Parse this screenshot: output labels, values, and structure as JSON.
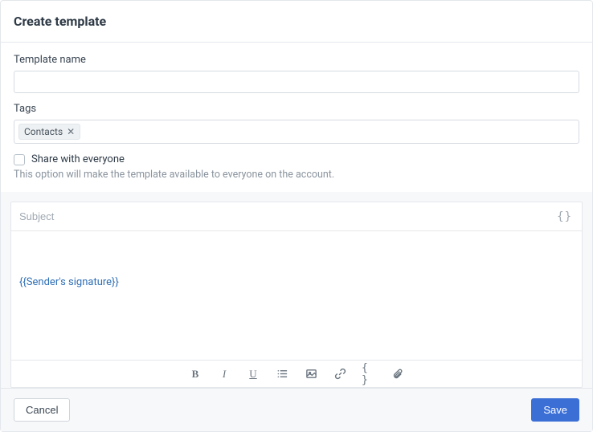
{
  "modal": {
    "title": "Create template"
  },
  "fields": {
    "template_name": {
      "label": "Template name",
      "value": ""
    },
    "tags": {
      "label": "Tags",
      "items": [
        {
          "label": "Contacts"
        }
      ]
    },
    "share": {
      "label": "Share with everyone",
      "help": "This option will make the template available to everyone on the account.",
      "checked": false
    }
  },
  "editor": {
    "subject_placeholder": "Subject",
    "body": {
      "signature_token": "{{Sender's signature}}"
    },
    "insert_var_glyph": "{}"
  },
  "toolbar": {
    "bold": "B",
    "italic": "I",
    "underline": "U",
    "vars": "{ }"
  },
  "footer": {
    "cancel": "Cancel",
    "save": "Save"
  }
}
